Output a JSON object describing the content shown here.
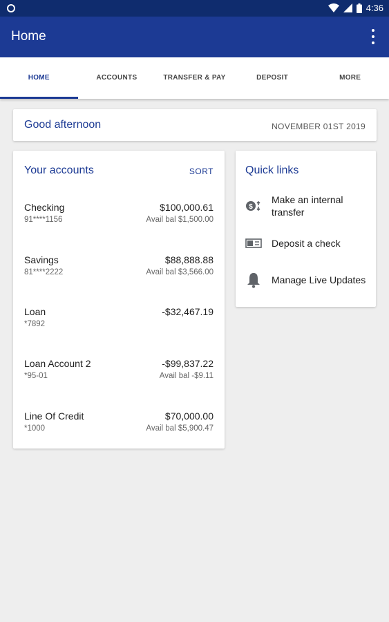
{
  "status_bar": {
    "time": "4:36"
  },
  "app_bar": {
    "title": "Home"
  },
  "tabs": [
    {
      "label": "HOME",
      "active": true
    },
    {
      "label": "ACCOUNTS"
    },
    {
      "label": "TRANSFER & PAY"
    },
    {
      "label": "DEPOSIT"
    },
    {
      "label": "MORE"
    }
  ],
  "greeting": {
    "text": "Good afternoon",
    "date": "NOVEMBER 01ST 2019"
  },
  "accounts": {
    "title": "Your accounts",
    "sort_label": "SORT",
    "items": [
      {
        "name": "Checking",
        "number": "91****1156",
        "balance": "$100,000.61",
        "available": "Avail bal $1,500.00"
      },
      {
        "name": "Savings",
        "number": "81****2222",
        "balance": "$88,888.88",
        "available": "Avail bal $3,566.00"
      },
      {
        "name": "Loan",
        "number": "*7892",
        "balance": "-$32,467.19",
        "available": ""
      },
      {
        "name": "Loan Account 2",
        "number": "*95-01",
        "balance": "-$99,837.22",
        "available": "Avail bal -$9.11"
      },
      {
        "name": "Line Of Credit",
        "number": "*1000",
        "balance": "$70,000.00",
        "available": "Avail bal $5,900.47"
      }
    ]
  },
  "quick_links": {
    "title": "Quick links",
    "items": [
      {
        "label": "Make an internal transfer",
        "icon": "transfer-icon"
      },
      {
        "label": "Deposit a check",
        "icon": "check-deposit-icon"
      },
      {
        "label": "Manage Live Updates",
        "icon": "bell-icon"
      }
    ]
  },
  "colors": {
    "status_bar": "#0f2c6e",
    "app_bar": "#1c3a94",
    "accent": "#1c3a94",
    "background": "#eeeeee"
  }
}
